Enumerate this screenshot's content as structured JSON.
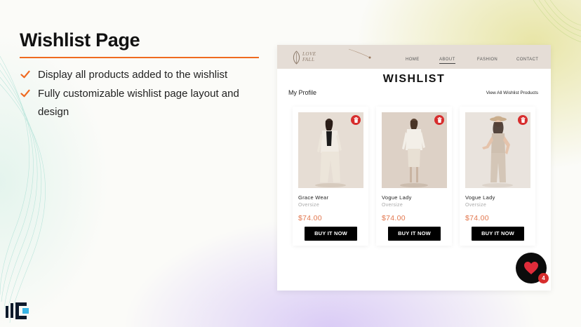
{
  "slide": {
    "title": "Wishlist Page",
    "bullets": [
      "Display all products added to the wishlist",
      "Fully customizable wishlist page layout and design"
    ],
    "accent_color": "#ef6a20"
  },
  "mock": {
    "logo_line1": "LOVE",
    "logo_line2": "FALL",
    "nav": [
      "HOME",
      "ABOUT",
      "FASHION",
      "CONTACT"
    ],
    "active_nav": "ABOUT",
    "heading": "WISHLIST",
    "my_profile": "My Profile",
    "view_all": "View All Wishlist Products",
    "products": [
      {
        "name": "Grace Wear",
        "category": "Oversize",
        "price": "$74.00",
        "button": "BUY IT NOW"
      },
      {
        "name": "Vogue Lady",
        "category": "Oversize",
        "price": "$74.00",
        "button": "BUY IT NOW"
      },
      {
        "name": "Vogue Lady",
        "category": "Oversize",
        "price": "$74.00",
        "button": "BUY IT NOW"
      }
    ],
    "price_color": "#e2774e",
    "wishlist_count": "4"
  }
}
